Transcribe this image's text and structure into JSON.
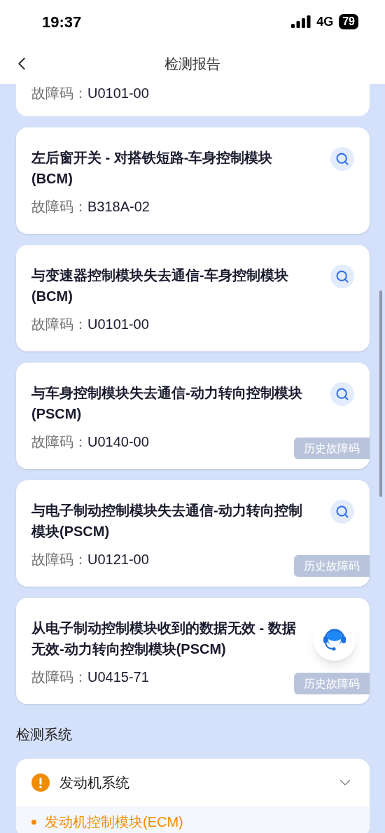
{
  "status_bar": {
    "time": "19:37",
    "network": "4G",
    "battery": "79"
  },
  "header": {
    "title": "检测报告"
  },
  "partial_card": {
    "code_label": "故障码：",
    "code": "U0101-00"
  },
  "faults": [
    {
      "title": "左后窗开关 - 对搭铁短路-车身控制模块(BCM)",
      "code_label": "故障码：",
      "code": "B318A-02",
      "search": true
    },
    {
      "title": "与变速器控制模块失去通信-车身控制模块(BCM)",
      "code_label": "故障码：",
      "code": "U0101-00",
      "search": true
    },
    {
      "title": "与车身控制模块失去通信-动力转向控制模块(PSCM)",
      "code_label": "故障码：",
      "code": "U0140-00",
      "search": true,
      "history": "历史故障码"
    },
    {
      "title": "与电子制动控制模块失去通信-动力转向控制模块(PSCM)",
      "code_label": "故障码：",
      "code": "U0121-00",
      "search": true,
      "history": "历史故障码"
    },
    {
      "title": "从电子制动控制模块收到的数据无效 - 数据无效-动力转向控制模块(PSCM)",
      "code_label": "故障码：",
      "code": "U0415-71",
      "search": false,
      "history": "历史故障码"
    }
  ],
  "systems_heading": "检测系统",
  "systems": [
    {
      "name": "发动机系统",
      "warning": true,
      "expanded": true,
      "modules": [
        "发动机控制模块(ECM)"
      ]
    }
  ]
}
